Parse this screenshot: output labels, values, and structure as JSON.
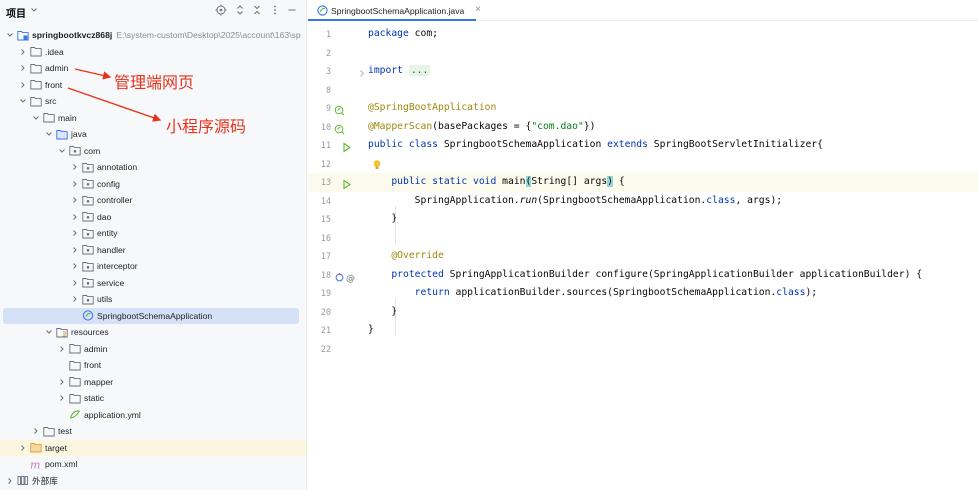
{
  "panel": {
    "title": "项目",
    "header_icons": [
      "target-icon",
      "expand-icon",
      "collapse-icon",
      "more-icon",
      "minimize-icon"
    ]
  },
  "tree": [
    {
      "label": "springbootkvcz868j",
      "path": "E:\\system-custom\\Desktop\\2025\\account\\163\\sp",
      "depth": 0,
      "expanded": true,
      "icon": "module-folder-icon",
      "bold": true
    },
    {
      "label": ".idea",
      "depth": 1,
      "expanded": false,
      "icon": "folder-icon"
    },
    {
      "label": "admin",
      "depth": 1,
      "expanded": false,
      "icon": "folder-icon"
    },
    {
      "label": "front",
      "depth": 1,
      "expanded": false,
      "icon": "folder-icon"
    },
    {
      "label": "src",
      "depth": 1,
      "expanded": true,
      "icon": "folder-icon"
    },
    {
      "label": "main",
      "depth": 2,
      "expanded": true,
      "icon": "folder-icon"
    },
    {
      "label": "java",
      "depth": 3,
      "expanded": true,
      "icon": "source-folder-icon"
    },
    {
      "label": "com",
      "depth": 4,
      "expanded": true,
      "icon": "package-icon"
    },
    {
      "label": "annotation",
      "depth": 5,
      "expanded": false,
      "icon": "package-icon"
    },
    {
      "label": "config",
      "depth": 5,
      "expanded": false,
      "icon": "package-icon"
    },
    {
      "label": "controller",
      "depth": 5,
      "expanded": false,
      "icon": "package-icon"
    },
    {
      "label": "dao",
      "depth": 5,
      "expanded": false,
      "icon": "package-icon"
    },
    {
      "label": "entity",
      "depth": 5,
      "expanded": false,
      "icon": "package-icon"
    },
    {
      "label": "handler",
      "depth": 5,
      "expanded": false,
      "icon": "package-icon"
    },
    {
      "label": "interceptor",
      "depth": 5,
      "expanded": false,
      "icon": "package-icon"
    },
    {
      "label": "service",
      "depth": 5,
      "expanded": false,
      "icon": "package-icon"
    },
    {
      "label": "utils",
      "depth": 5,
      "expanded": false,
      "icon": "package-icon"
    },
    {
      "label": "SpringbootSchemaApplication",
      "depth": 5,
      "leaf": true,
      "icon": "spring-class-icon",
      "selected": true
    },
    {
      "label": "resources",
      "depth": 3,
      "expanded": true,
      "icon": "resources-folder-icon"
    },
    {
      "label": "admin",
      "depth": 4,
      "expanded": false,
      "icon": "folder-icon"
    },
    {
      "label": "front",
      "depth": 4,
      "leaf": true,
      "icon": "folder-icon"
    },
    {
      "label": "mapper",
      "depth": 4,
      "expanded": false,
      "icon": "folder-icon"
    },
    {
      "label": "static",
      "depth": 4,
      "expanded": false,
      "icon": "folder-icon"
    },
    {
      "label": "application.yml",
      "depth": 4,
      "leaf": true,
      "icon": "yaml-file-icon"
    },
    {
      "label": "test",
      "depth": 2,
      "expanded": false,
      "icon": "folder-icon"
    },
    {
      "label": "target",
      "depth": 1,
      "expanded": false,
      "icon": "excluded-folder-icon",
      "excluded": true
    },
    {
      "label": "pom.xml",
      "depth": 1,
      "leaf": true,
      "icon": "maven-icon"
    },
    {
      "label": "外部库",
      "depth": 0,
      "expanded": false,
      "icon": "library-icon"
    }
  ],
  "annotations": {
    "admin_note": "管理端网页",
    "front_note": "小程序源码",
    "color": "#e8331c"
  },
  "editor": {
    "tab_label": "SpringbootSchemaApplication.java",
    "tab_close": "×",
    "current_line": 13,
    "lines": [
      {
        "n": "1",
        "html": "<span class=\"kw\">package</span> com;"
      },
      {
        "n": "2",
        "html": ""
      },
      {
        "n": "3",
        "html": "<span class=\"kw\">import</span> <span class=\"fold\">...</span>"
      },
      {
        "n": "8",
        "html": ""
      },
      {
        "n": "9",
        "html": "<span class=\"an\">@SpringBootApplication</span>"
      },
      {
        "n": "10",
        "html": "<span class=\"an\">@MapperScan</span>(basePackages = {<span class=\"st\">\"com.dao\"</span>})"
      },
      {
        "n": "11",
        "html": "<span class=\"kw\">public class</span> SpringbootSchemaApplication <span class=\"kw\">extends</span> SpringBootServletInitializer{"
      },
      {
        "n": "12",
        "html": ""
      },
      {
        "n": "13",
        "html": "    <span class=\"kw\">public static void</span> main<span class=\"bracket\">(</span>String[] args<span class=\"bracket\">)</span> {"
      },
      {
        "n": "14",
        "html": "        SpringApplication.<span class=\"it\">run</span>(SpringbootSchemaApplication.<span class=\"kw\">class</span>, args);"
      },
      {
        "n": "15",
        "html": "    }"
      },
      {
        "n": "16",
        "html": ""
      },
      {
        "n": "17",
        "html": "    <span class=\"an\">@Override</span>"
      },
      {
        "n": "18",
        "html": "    <span class=\"kw\">protected</span> SpringApplicationBuilder configure(SpringApplicationBuilder applicationBuilder) {"
      },
      {
        "n": "19",
        "html": "        <span class=\"kw\">return</span> applicationBuilder.sources(SpringbootSchemaApplication.<span class=\"kw\">class</span>);"
      },
      {
        "n": "20",
        "html": "    }"
      },
      {
        "n": "21",
        "html": "}"
      },
      {
        "n": "22",
        "html": ""
      }
    ]
  }
}
